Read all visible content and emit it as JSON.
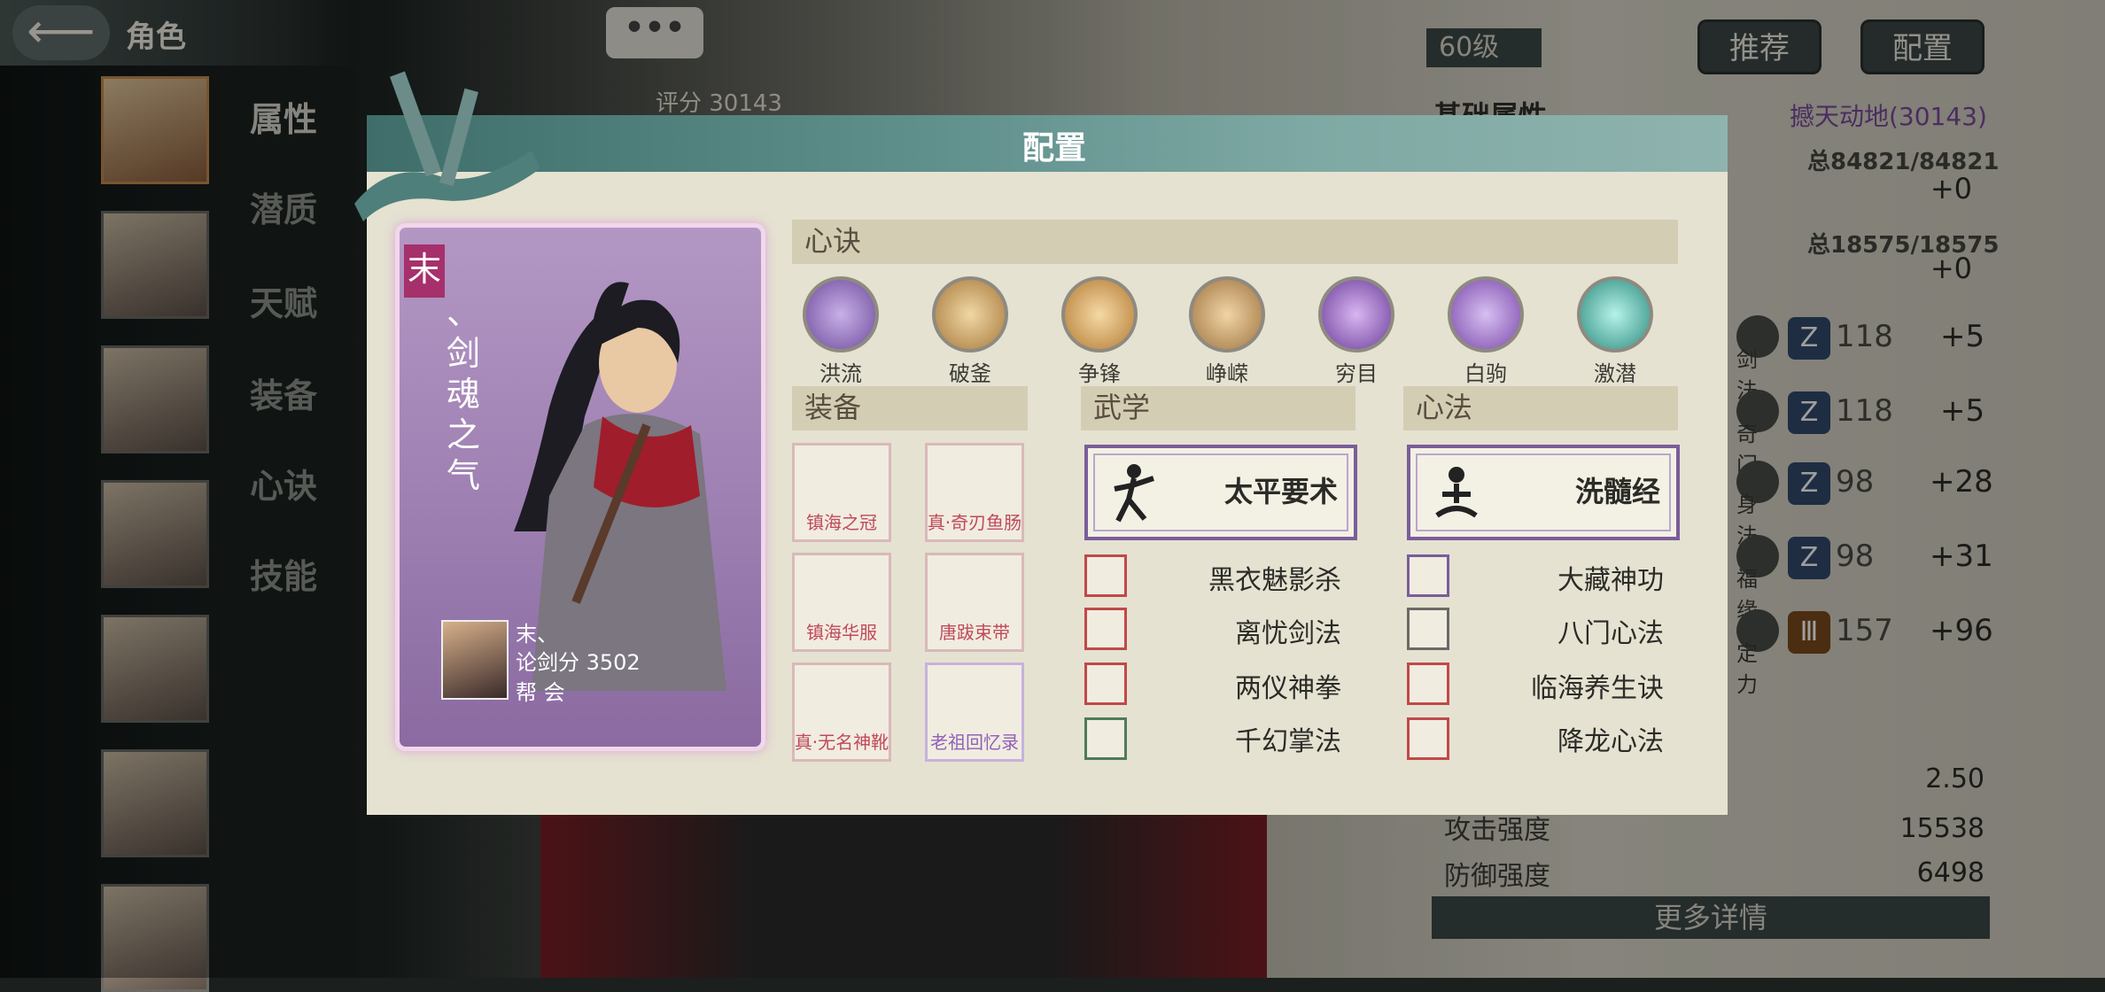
{
  "top_bar": {
    "back_icon": "arrow-left-icon",
    "title": "角色"
  },
  "sidebar": {
    "labels": [
      "属性",
      "潜质",
      "天赋",
      "装备",
      "心诀",
      "技能"
    ],
    "selected_label": "属性"
  },
  "chat": {
    "label": "•••"
  },
  "score": {
    "text": "评分 30143"
  },
  "stats_panel": {
    "level": "60级",
    "recommend_button": "推荐",
    "config_button": "配置",
    "basic_title": "基础属性",
    "power": "撼天动地(30143)",
    "hp_total": "总84821/84821",
    "hp_plus": "+0",
    "mp_total": "总18575/18575",
    "mp_plus": "+0",
    "attrs": [
      {
        "name": "剑法",
        "value": "118",
        "plus": "+5"
      },
      {
        "name": "奇门",
        "value": "118",
        "plus": "+5"
      },
      {
        "name": "身法",
        "value": "98",
        "plus": "+28"
      },
      {
        "name": "福缘",
        "value": "98",
        "plus": "+31"
      },
      {
        "name": "定力",
        "value": "157",
        "plus": "+96"
      }
    ],
    "extra_val": "2.50",
    "attack_label": "攻击强度",
    "attack_val": "15538",
    "defense_label": "防御强度",
    "defense_val": "6498",
    "more_button": "更多详情"
  },
  "modal": {
    "title": "配置",
    "card": {
      "name": "末",
      "title_text": "、剑魂之气",
      "player_name": "末、",
      "sword_score": "论剑分 3502",
      "guild": "帮  会"
    },
    "xinjue_header": "心诀",
    "xinjue": [
      {
        "label": "洪流",
        "icon": "swirl-icon",
        "color": "#7b5aa6"
      },
      {
        "label": "破釜",
        "icon": "shield-icon",
        "color": "#b08a4a"
      },
      {
        "label": "争锋",
        "icon": "fist-icon",
        "color": "#c08a3a"
      },
      {
        "label": "峥嵘",
        "icon": "cloud-icon",
        "color": "#b0804a"
      },
      {
        "label": "穷目",
        "icon": "eye-icon",
        "color": "#7a4aa6"
      },
      {
        "label": "白驹",
        "icon": "horse-icon",
        "color": "#8a5ab6"
      },
      {
        "label": "激潜",
        "icon": "vortex-icon",
        "color": "#3aa69a"
      }
    ],
    "equip_header": "装备",
    "equipment": [
      {
        "label": "镇海之冠",
        "icon": "helmet-icon"
      },
      {
        "label": "真·奇刃鱼肠",
        "icon": "sword-icon"
      },
      {
        "label": "镇海华服",
        "icon": "robe-icon"
      },
      {
        "label": "唐跋束带",
        "icon": "belt-icon"
      },
      {
        "label": "真·无名神靴",
        "icon": "boots-icon"
      },
      {
        "label": "老祖回忆录",
        "icon": "book-icon"
      }
    ],
    "wuxue_header": "武学",
    "wuxue_primary": "太平要术",
    "wuxue": [
      "黑衣魅影杀",
      "离忧剑法",
      "两仪神拳",
      "千幻掌法"
    ],
    "xinfa_header": "心法",
    "xinfa_primary": "洗髓经",
    "xinfa": [
      "大藏神功",
      "八门心法",
      "临海养生诀",
      "降龙心法"
    ]
  }
}
